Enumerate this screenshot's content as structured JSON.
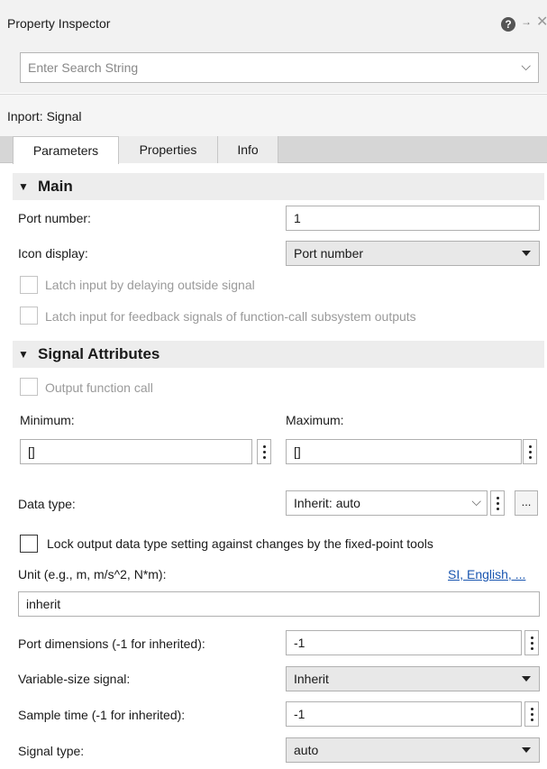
{
  "window": {
    "title": "Property Inspector"
  },
  "search": {
    "placeholder": "Enter Search String"
  },
  "block": {
    "name": "Inport: Signal"
  },
  "tabs": [
    {
      "label": "Parameters",
      "active": true
    },
    {
      "label": "Properties",
      "active": false
    },
    {
      "label": "Info",
      "active": false
    }
  ],
  "main_section": {
    "title": "Main",
    "port_number_label": "Port number:",
    "port_number_value": "1",
    "icon_display_label": "Icon display:",
    "icon_display_value": "Port number",
    "latch_delay_label": "Latch input by delaying outside signal",
    "latch_feedback_label": "Latch input for feedback signals of function-call subsystem outputs"
  },
  "signal_section": {
    "title": "Signal Attributes",
    "output_function_call_label": "Output function call",
    "minimum_label": "Minimum:",
    "minimum_value": "[]",
    "maximum_label": "Maximum:",
    "maximum_value": "[]",
    "data_type_label": "Data type:",
    "data_type_value": "Inherit: auto",
    "data_type_assistant_label": "...",
    "lock_label": "Lock output data type setting against changes by the fixed-point tools",
    "unit_label": "Unit (e.g., m, m/s^2, N*m):",
    "unit_link": "SI, English, ...",
    "unit_value": "inherit",
    "port_dimensions_label": "Port dimensions (-1 for inherited):",
    "port_dimensions_value": "-1",
    "variable_size_label": "Variable-size signal:",
    "variable_size_value": "Inherit",
    "sample_time_label": "Sample time (-1 for inherited):",
    "sample_time_value": "-1",
    "signal_type_label": "Signal type:",
    "signal_type_value": "auto"
  },
  "icons": [
    "help-icon",
    "pin-icon",
    "close-icon",
    "chevron-down-icon",
    "triangle-down-icon",
    "more-options-icon"
  ]
}
